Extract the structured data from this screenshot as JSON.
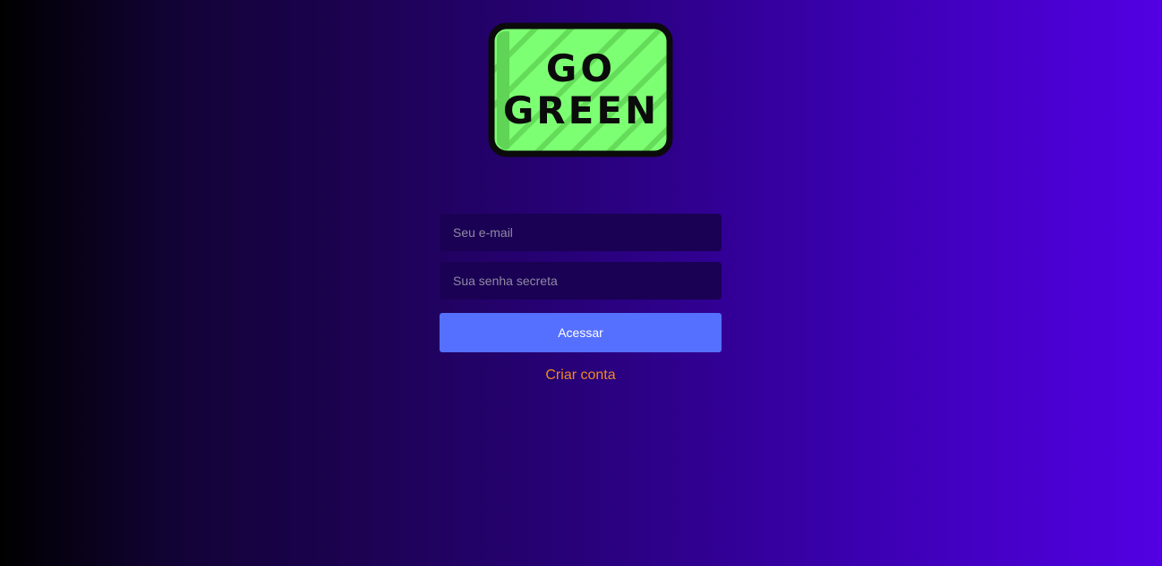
{
  "logo": {
    "line1": "GO",
    "line2": "GREEN"
  },
  "login_form": {
    "email_placeholder": "Seu e-mail",
    "password_placeholder": "Sua senha secreta",
    "submit_label": "Acessar",
    "signup_link": "Criar conta"
  },
  "colors": {
    "logo_green": "#7dff73",
    "button_blue": "#5570ff",
    "link_orange": "#f08a1c"
  }
}
